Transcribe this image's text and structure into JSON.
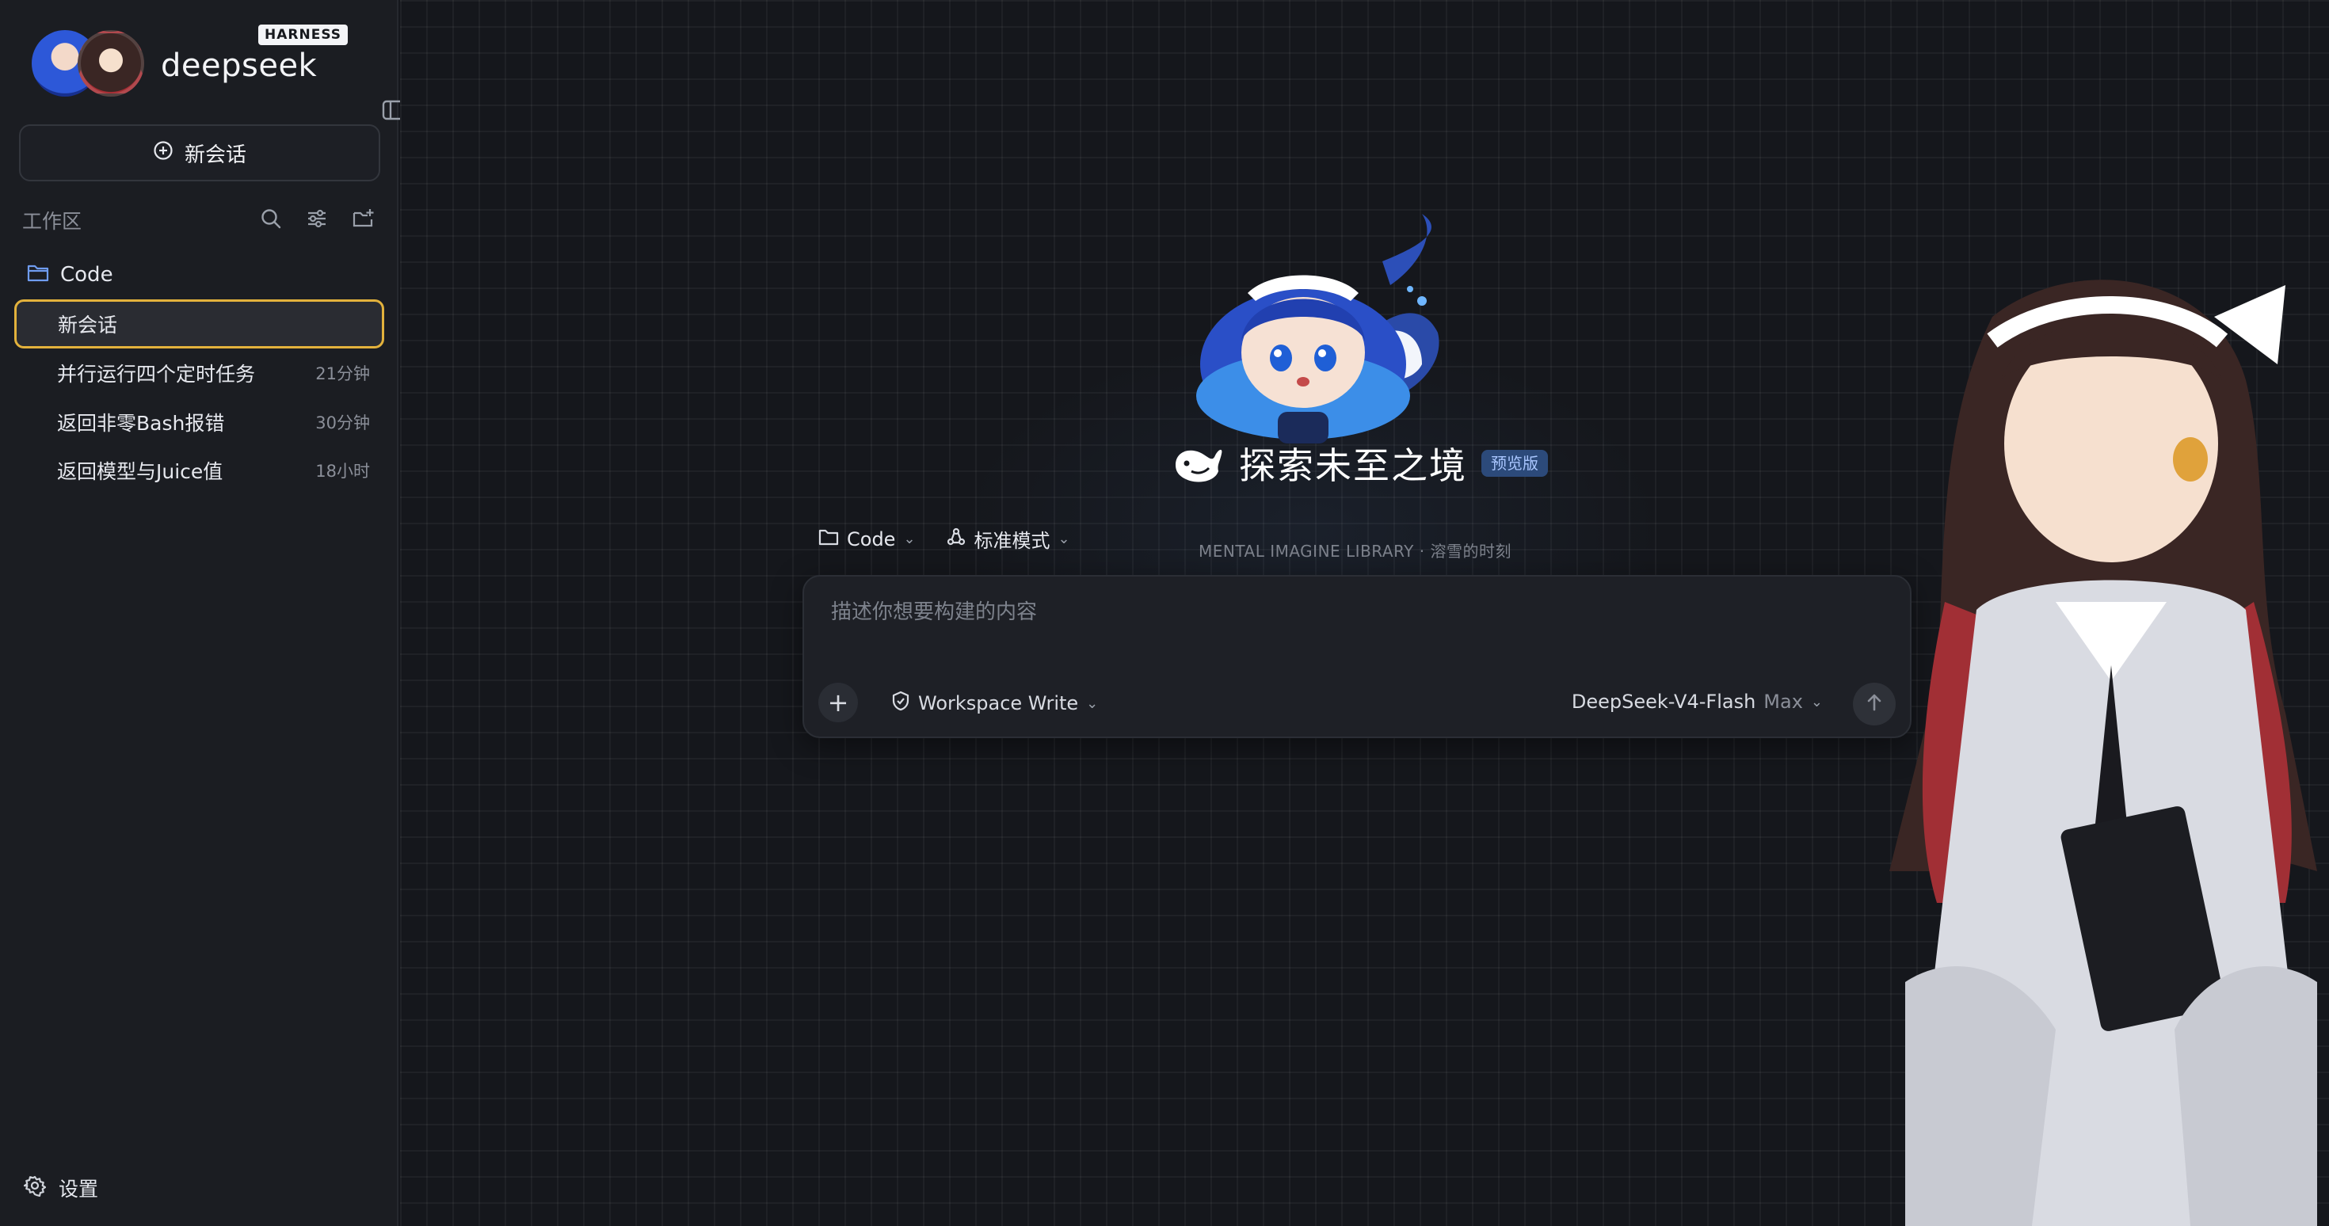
{
  "app": {
    "logo_text": "deepseek",
    "badge": "HARNESS"
  },
  "sidebar": {
    "new_chat_label": "新会话",
    "workspace_title": "工作区",
    "folder": {
      "name": "Code"
    },
    "sessions": [
      {
        "title": "新会话",
        "time": "",
        "active": true
      },
      {
        "title": "并行运行四个定时任务",
        "time": "21分钟",
        "active": false
      },
      {
        "title": "返回非零Bash报错",
        "time": "30分钟",
        "active": false
      },
      {
        "title": "返回模型与Juice值",
        "time": "18小时",
        "active": false
      }
    ],
    "settings_label": "设置"
  },
  "main": {
    "title": "探索未至之境",
    "preview_badge": "预览版",
    "folder_selector": "Code",
    "mode_selector": "标准模式",
    "library_line": "MENTAL IMAGINE LIBRARY · 溶雪的时刻",
    "composer": {
      "placeholder": "描述你想要构建的内容",
      "permission": "Workspace Write",
      "model": "DeepSeek-V4-Flash",
      "effort": "Max"
    }
  },
  "colors": {
    "accent_border": "#e3b23c",
    "preview_badge_bg": "#2c4a7a",
    "background": "#15171c",
    "sidebar_bg": "#1b1d22"
  },
  "icons": [
    "collapse-sidebar-icon",
    "plus-circle-icon",
    "search-icon",
    "filter-icon",
    "add-folder-icon",
    "folder-icon",
    "gear-icon",
    "whale-icon",
    "chevron-down-icon",
    "shield-icon",
    "arrow-up-icon",
    "plus-icon"
  ]
}
